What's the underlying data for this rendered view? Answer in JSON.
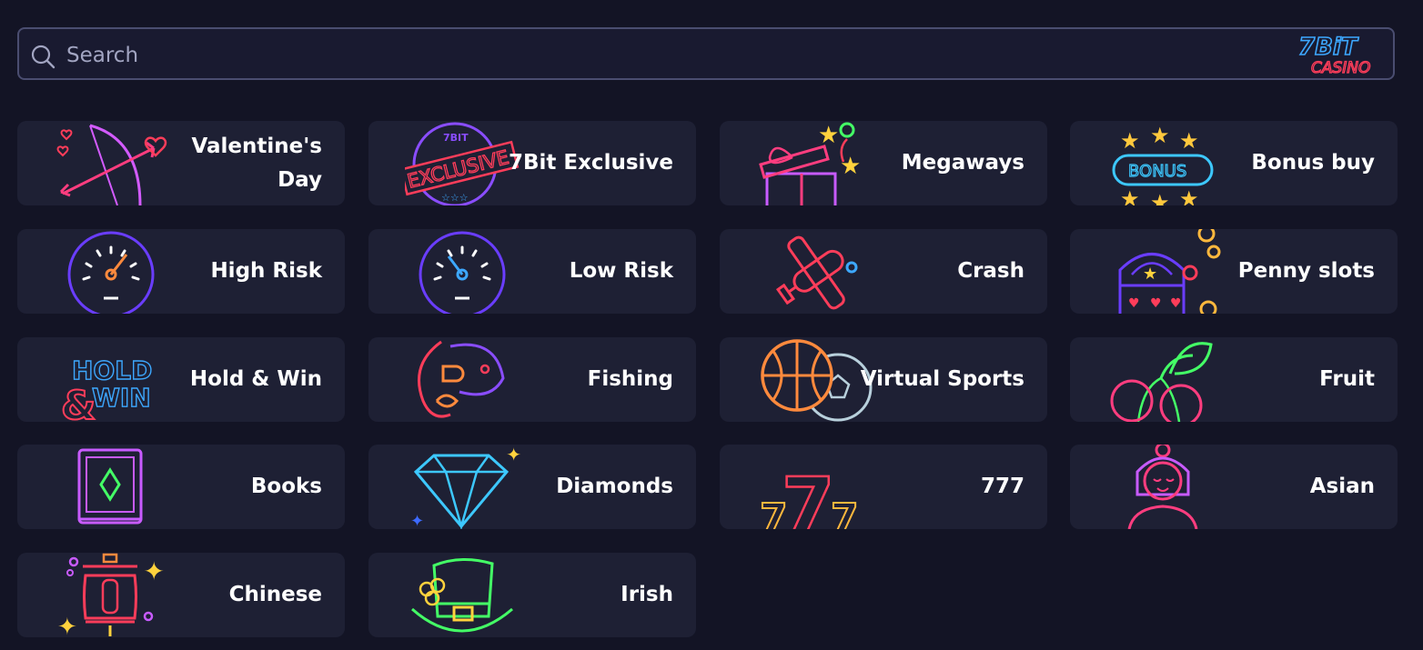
{
  "search": {
    "placeholder": "Search",
    "value": ""
  },
  "logo": {
    "line1": "7BiT",
    "line2": "CASINO"
  },
  "categories": [
    {
      "label": "Valentine's Day",
      "icon": "bow-and-arrow-icon"
    },
    {
      "label": "7Bit Exclusive",
      "icon": "exclusive-stamp-icon"
    },
    {
      "label": "Megaways",
      "icon": "gift-box-icon"
    },
    {
      "label": "Bonus buy",
      "icon": "bonus-stars-icon"
    },
    {
      "label": "High Risk",
      "icon": "speedometer-high-icon"
    },
    {
      "label": "Low Risk",
      "icon": "speedometer-low-icon"
    },
    {
      "label": "Crash",
      "icon": "airplane-icon"
    },
    {
      "label": "Penny slots",
      "icon": "piggy-coins-icon"
    },
    {
      "label": "Hold & Win",
      "icon": "hold-and-win-icon"
    },
    {
      "label": "Fishing",
      "icon": "fish-icon"
    },
    {
      "label": "Virtual Sports",
      "icon": "balls-icon"
    },
    {
      "label": "Fruit",
      "icon": "cherries-icon"
    },
    {
      "label": "Books",
      "icon": "book-icon"
    },
    {
      "label": "Diamonds",
      "icon": "diamond-icon"
    },
    {
      "label": "777",
      "icon": "lucky-seven-icon"
    },
    {
      "label": "Asian",
      "icon": "asian-girl-icon"
    },
    {
      "label": "Chinese",
      "icon": "lantern-icon"
    },
    {
      "label": "Irish",
      "icon": "leprechaun-hat-icon"
    }
  ],
  "colors": {
    "background": "#131425",
    "card": "#1e2034",
    "search_border": "#4a4d70",
    "neon_pink": "#ff3d7f",
    "neon_purple": "#9b3dff",
    "neon_blue": "#3da8ff",
    "neon_yellow": "#ffd23d"
  }
}
